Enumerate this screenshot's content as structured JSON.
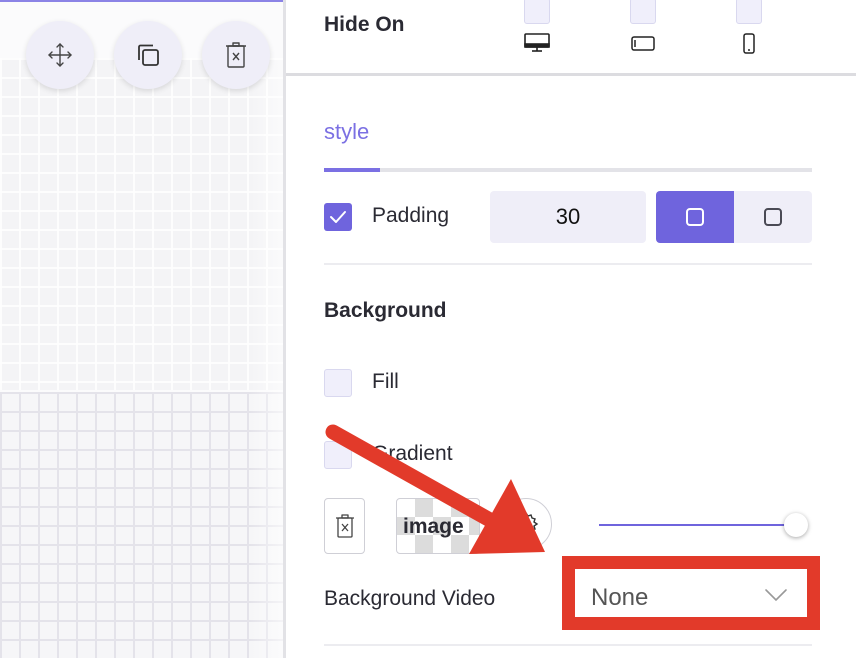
{
  "canvas": {
    "toolbar": [
      {
        "name": "move-icon"
      },
      {
        "name": "duplicate-icon"
      },
      {
        "name": "delete-icon"
      }
    ]
  },
  "visibility": {
    "label": "Hide On",
    "devices": [
      {
        "icon": "desktop-icon",
        "checked": false
      },
      {
        "icon": "tablet-icon",
        "checked": false
      },
      {
        "icon": "mobile-icon",
        "checked": false
      }
    ]
  },
  "tabs": {
    "active_label": "style"
  },
  "padding": {
    "label": "Padding",
    "checked": true,
    "value": "30",
    "modes": [
      "all-sides-icon",
      "individual-sides-icon"
    ]
  },
  "background": {
    "title": "Background",
    "fill_label": "Fill",
    "fill_checked": false,
    "gradient_label": "Gradient",
    "gradient_checked": false,
    "image_label": "image",
    "opacity_level": 1.0,
    "video_label": "Background Video",
    "video_value": "None"
  },
  "colors": {
    "accent": "#6f64dd",
    "annotation_red": "#e23a2a"
  }
}
